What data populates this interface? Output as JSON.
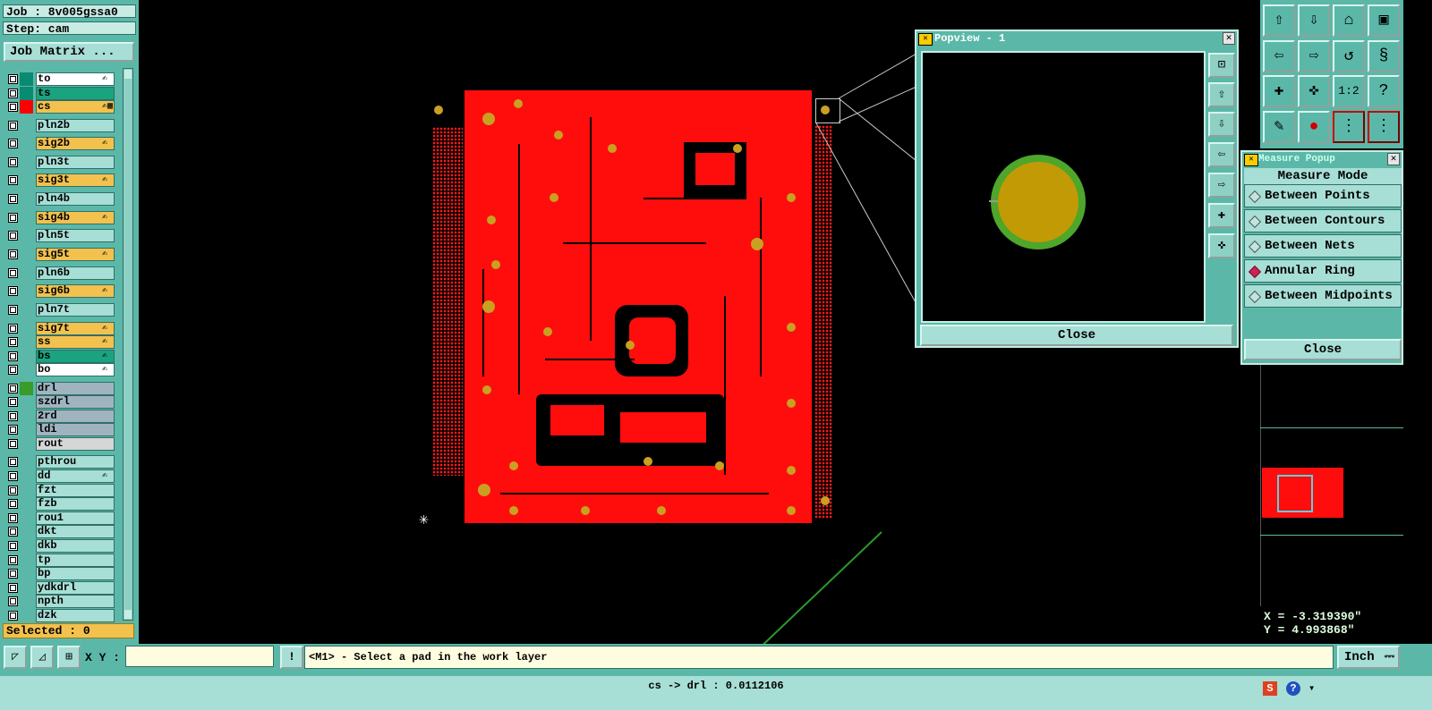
{
  "job_label": "Job : 8v005gssa0",
  "step_label": "Step: cam",
  "job_matrix_label": "Job Matrix ...",
  "layers": [
    {
      "name": "to",
      "color": "#ffffff",
      "swatch": "#0a8a70",
      "edit": "✍"
    },
    {
      "name": "ts",
      "color": "#1aa37f",
      "swatch": "#0a8a70",
      "edit": ""
    },
    {
      "name": "cs",
      "color": "#f2c14e",
      "swatch": "#ff0000",
      "edit": "✍▦"
    },
    {
      "name": "pln2b",
      "color": "#a7ded5",
      "swatch": "#5bb8a8",
      "edit": ""
    },
    {
      "name": "sig2b",
      "color": "#f2c14e",
      "swatch": "#5bb8a8",
      "edit": "✍"
    },
    {
      "name": "pln3t",
      "color": "#a7ded5",
      "swatch": "#5bb8a8",
      "edit": ""
    },
    {
      "name": "sig3t",
      "color": "#f2c14e",
      "swatch": "#5bb8a8",
      "edit": "✍"
    },
    {
      "name": "pln4b",
      "color": "#a7ded5",
      "swatch": "#5bb8a8",
      "edit": ""
    },
    {
      "name": "sig4b",
      "color": "#f2c14e",
      "swatch": "#5bb8a8",
      "edit": "✍"
    },
    {
      "name": "pln5t",
      "color": "#a7ded5",
      "swatch": "#5bb8a8",
      "edit": ""
    },
    {
      "name": "sig5t",
      "color": "#f2c14e",
      "swatch": "#5bb8a8",
      "edit": "✍"
    },
    {
      "name": "pln6b",
      "color": "#a7ded5",
      "swatch": "#5bb8a8",
      "edit": ""
    },
    {
      "name": "sig6b",
      "color": "#f2c14e",
      "swatch": "#5bb8a8",
      "edit": "✍"
    },
    {
      "name": "pln7t",
      "color": "#a7ded5",
      "swatch": "#5bb8a8",
      "edit": ""
    },
    {
      "name": "sig7t",
      "color": "#f2c14e",
      "swatch": "#5bb8a8",
      "edit": "✍"
    },
    {
      "name": "ss",
      "color": "#f2c14e",
      "swatch": "#5bb8a8",
      "edit": "✍"
    },
    {
      "name": "bs",
      "color": "#1aa37f",
      "swatch": "#5bb8a8",
      "edit": "✍"
    },
    {
      "name": "bo",
      "color": "#ffffff",
      "swatch": "#5bb8a8",
      "edit": "✍"
    },
    {
      "name": "drl",
      "color": "#a0b4c0",
      "swatch": "#3a9a2a",
      "edit": ""
    },
    {
      "name": "szdrl",
      "color": "#a0b4c0",
      "swatch": "#5bb8a8",
      "edit": ""
    },
    {
      "name": "2rd",
      "color": "#a0b4c0",
      "swatch": "#5bb8a8",
      "edit": ""
    },
    {
      "name": "ldi",
      "color": "#a0b4c0",
      "swatch": "#5bb8a8",
      "edit": ""
    },
    {
      "name": "rout",
      "color": "#d6d6d6",
      "swatch": "#5bb8a8",
      "edit": ""
    },
    {
      "name": "pthrou",
      "color": "#a7ded5",
      "swatch": "#5bb8a8",
      "edit": ""
    },
    {
      "name": "dd",
      "color": "#a7ded5",
      "swatch": "#5bb8a8",
      "edit": "✍"
    },
    {
      "name": "fzt",
      "color": "#a7ded5",
      "swatch": "#5bb8a8",
      "edit": ""
    },
    {
      "name": "fzb",
      "color": "#a7ded5",
      "swatch": "#5bb8a8",
      "edit": ""
    },
    {
      "name": "rou1",
      "color": "#a7ded5",
      "swatch": "#5bb8a8",
      "edit": ""
    },
    {
      "name": "dkt",
      "color": "#a7ded5",
      "swatch": "#5bb8a8",
      "edit": ""
    },
    {
      "name": "dkb",
      "color": "#a7ded5",
      "swatch": "#5bb8a8",
      "edit": ""
    },
    {
      "name": "tp",
      "color": "#a7ded5",
      "swatch": "#5bb8a8",
      "edit": ""
    },
    {
      "name": "bp",
      "color": "#a7ded5",
      "swatch": "#5bb8a8",
      "edit": ""
    },
    {
      "name": "ydkdrl",
      "color": "#a7ded5",
      "swatch": "#5bb8a8",
      "edit": ""
    },
    {
      "name": "npth",
      "color": "#a7ded5",
      "swatch": "#5bb8a8",
      "edit": ""
    },
    {
      "name": "dzk",
      "color": "#a7ded5",
      "swatch": "#5bb8a8",
      "edit": ""
    }
  ],
  "selected_label": "Selected : 0",
  "popview": {
    "title": "Popview - 1",
    "close_label": "Close",
    "close_x": "✕"
  },
  "measure": {
    "title": "Measure Popup",
    "mode_label": "Measure Mode",
    "options": [
      "Between Points",
      "Between Contours",
      "Between Nets",
      "Annular Ring",
      "Between Midpoints"
    ],
    "selected_option": "Annular Ring",
    "close_label": "Close",
    "close_x": "✕"
  },
  "coords": {
    "x": "X = -3.319390\"",
    "y": "Y = 4.993868\""
  },
  "bottom": {
    "xy_label": "X Y :",
    "xy_value": "",
    "alert_icon": "!",
    "prompt": "<M1> - Select a pad in the work layer",
    "units": "Inch",
    "status": "cs -> drl : 0.0112106"
  },
  "colors": {
    "board": "#ff0d0d",
    "pad": "#c9a021",
    "ring": "#4ea62a",
    "ui": "#5bb8a8"
  }
}
